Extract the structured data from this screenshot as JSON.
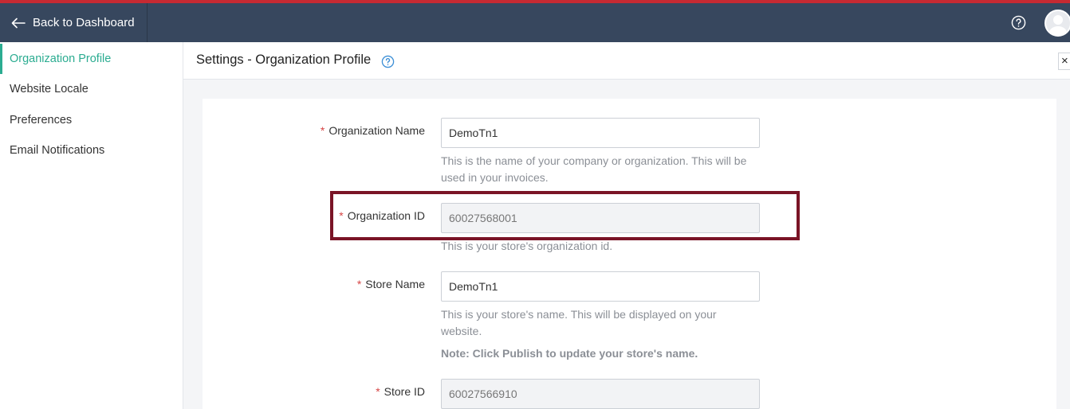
{
  "colors": {
    "accent_line": "#c62a32",
    "topbar": "#37475e",
    "active_sidebar": "#2bac91",
    "required_asterisk": "#d64545",
    "highlight_box": "#7a1426"
  },
  "topbar": {
    "back_icon": "arrow-left-icon",
    "back_label": "Back to Dashboard",
    "help_icon": "help-circle-icon",
    "avatar_icon": "user-avatar-icon"
  },
  "sidebar": {
    "items": [
      {
        "label": "Organization Profile",
        "active": true
      },
      {
        "label": "Website Locale",
        "active": false
      },
      {
        "label": "Preferences",
        "active": false
      },
      {
        "label": "Email Notifications",
        "active": false
      }
    ]
  },
  "header": {
    "title": "Settings - Organization Profile",
    "help_icon": "help-circle-icon",
    "close_icon": "close-icon",
    "close_glyph": "×"
  },
  "form": {
    "required_marker": "*",
    "org_name": {
      "label": "Organization Name",
      "value": "DemoTn1",
      "hint": "This is the name of your company or organization. This will be used in your invoices."
    },
    "org_id": {
      "label": "Organization ID",
      "value": "60027568001",
      "hint": "This is your store's organization id."
    },
    "store_name": {
      "label": "Store Name",
      "value": "DemoTn1",
      "hint": "This is your store's name. This will be displayed on your website.",
      "note": "Note: Click Publish to update your store's name."
    },
    "store_id": {
      "label": "Store ID",
      "value": "60027566910"
    }
  }
}
